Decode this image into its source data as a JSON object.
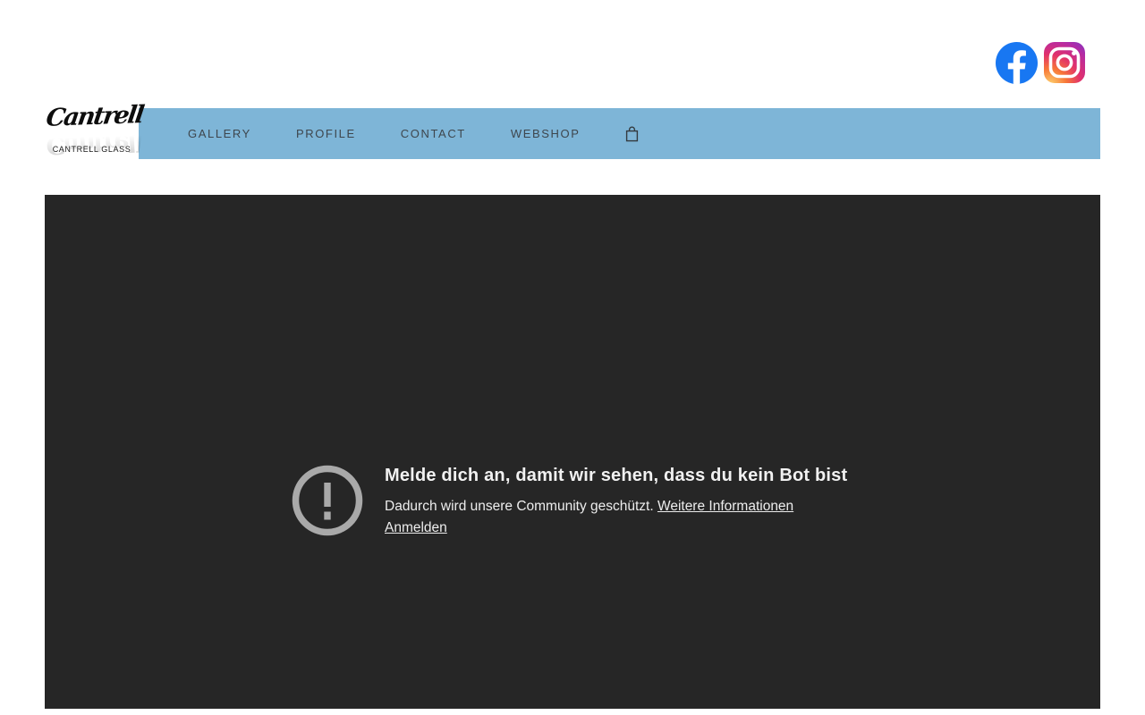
{
  "header": {
    "social": {
      "facebook_label": "Facebook",
      "instagram_label": "Instagram"
    }
  },
  "logo": {
    "script": "Cantrell",
    "caption": "CANTRELL GLASS"
  },
  "nav": {
    "items": [
      "GALLERY",
      "PROFILE",
      "CONTACT",
      "WEBSHOP"
    ],
    "cart_icon": "shopping-bag"
  },
  "embed_notice": {
    "icon": "alert-circle",
    "title": "Melde dich an, damit wir sehen, dass du kein Bot bist",
    "body": "Dadurch wird unsere Community geschützt.",
    "links": {
      "more_info": "Weitere Informationen",
      "sign_in": "Anmelden"
    }
  },
  "colors": {
    "nav_background": "#7eb5d7",
    "nav_text": "#3e464d",
    "embed_background": "#262626",
    "notice_text": "#ededed",
    "alert_icon_gray": "#a9a9a9",
    "facebook_blue": "#1877f2",
    "instagram_gradient": [
      "#f7c151",
      "#f55443",
      "#e1306c",
      "#9b36b7",
      "#6a3ad1"
    ]
  }
}
